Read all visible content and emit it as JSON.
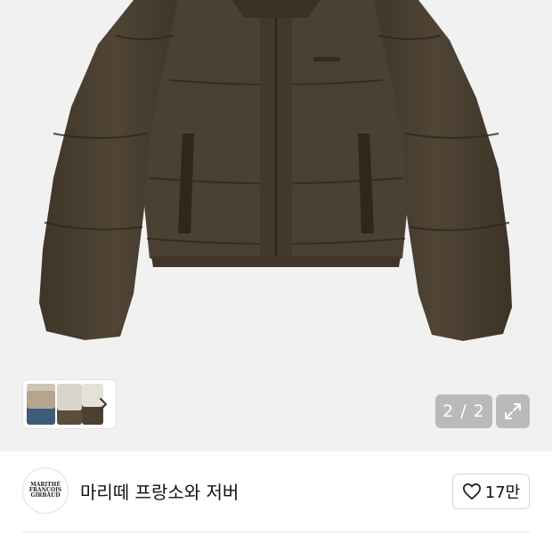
{
  "image_counter": "2 / 2",
  "brand": {
    "name": "마리떼 프랑소와 저버",
    "logo_text": "MARITHÉ\nFRANÇOIS\nGIRBAUD"
  },
  "like": {
    "count": "17만",
    "icon": "heart-outline-icon"
  },
  "icons": {
    "thumb_next": "chevron-right-icon",
    "fullscreen": "expand-arrows-icon"
  },
  "colors": {
    "jacket": "#4a4031",
    "hero_bg": "#f1f1f1",
    "overlay_button": "#8c8c8c"
  }
}
